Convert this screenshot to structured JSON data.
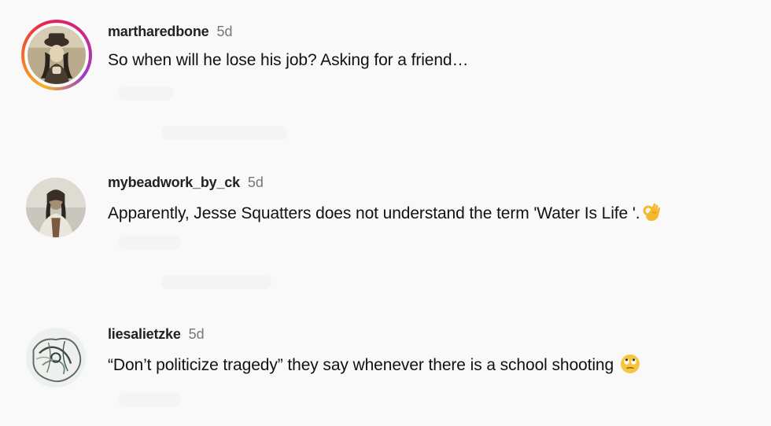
{
  "comments": [
    {
      "username": "martharedbone",
      "time": "5d",
      "text": "So when will he lose his job? Asking for a friend…",
      "avatar_icon": "profile-photo-with-story-ring"
    },
    {
      "username": "mybeadwork_by_ck",
      "time": "5d",
      "text": "Apparently, Jesse Squatters does not understand the term 'Water Is Life '.",
      "emoji_icon": "ok-hand-emoji",
      "avatar_icon": "profile-photo"
    },
    {
      "username": "liesalietzke",
      "time": "5d",
      "text": "“Don’t politicize tragedy” they say whenever there is a school shooting",
      "emoji_icon": "face-with-rolling-eyes-emoji",
      "avatar_icon": "profile-drawing"
    }
  ],
  "colors": {
    "background": "#f9f9fa",
    "username": "#222222",
    "timestamp": "#777777",
    "ring_gradient": [
      "#f5b32c",
      "#e3214f",
      "#9b3cc4"
    ]
  }
}
